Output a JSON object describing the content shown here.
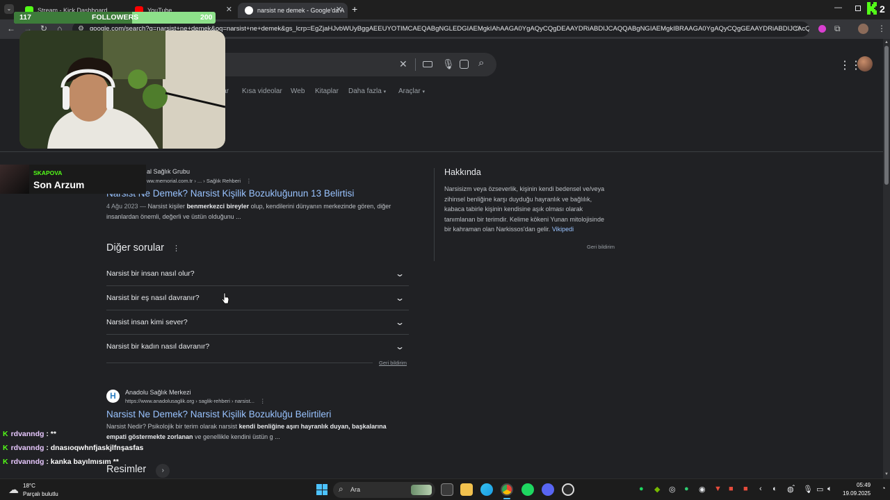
{
  "browser": {
    "tabs": [
      {
        "label": "Stream - Kick Dashboard",
        "active": false
      },
      {
        "label": "YouTube",
        "active": false
      },
      {
        "label": "narsist ne demek - Google'da A",
        "active": true
      }
    ],
    "new_tab": "+",
    "url": "google.com/search?q=narsist+ne+demek&oq=narsist+ne+demek&gs_lcrp=EgZjaHJvbWUyBggAEEUYOTIMCAEQABgNGLEDGIAEMgkIAhAAGA0YgAQyCQgDEAAYDRiABDIJCAQQABgNGIAEMgkIBRAAGA0YgAQyCQgGEAAYDRiABDIJCAcQABgN..."
  },
  "google": {
    "nav_tabs": [
      "lar",
      "Kısa videolar",
      "Web",
      "Kitaplar",
      "Daha fazla",
      "Araçlar"
    ],
    "result1": {
      "source_name": "al Sağlık Grubu",
      "source_url": "ww.memorial.com.tr › ... › Sağlık Rehberi",
      "title": "Narsist Ne Demek? Narsist Kişilik Bozukluğunun 13 Belirtisi",
      "date": "4 Ağu 2023 —",
      "snippet_a": " Narsist kişiler ",
      "snippet_b": "benmerkezci bireyler",
      "snippet_c": " olup, kendilerini dünyanın merkezinde gören, diğer",
      "snippet_line2": "insanlardan önemli, değerli ve üstün olduğunu ..."
    },
    "other_questions": {
      "heading": "Diğer sorular",
      "items": [
        "Narsist bir insan nasıl olur?",
        "Narsist bir eş nasıl davranır?",
        "Narsist insan kimi sever?",
        "Narsist bir kadın nasıl davranır?"
      ],
      "feedback": "Geri bildirim"
    },
    "result2": {
      "source_name": "Anadolu Sağlık Merkezi",
      "source_url": "https://www.anadolusaglik.org › saglik-rehberi › narsist...",
      "title": "Narsist Ne Demek? Narsist Kişilik Bozukluğu Belirtileri",
      "snippet_a": "Narsist Nedir? Psikolojik bir terim olarak narsist ",
      "snippet_b": "kendi benliğine aşırı hayranlık duyan, başkalarına",
      "snippet_c": "empati göstermekte zorlanan",
      "snippet_d": " ve genellikle kendini üstün g ..."
    },
    "images_heading": "Resimler",
    "about": {
      "heading": "Hakkında",
      "lines": [
        "Narsisizm veya özseverlik, kişinin kendi bedensel ve/veya",
        "zihinsel benliğine karşı duyduğu hayranlık ve bağlılık,",
        "kabaca tabirle kişinin kendisine aşık olması olarak",
        "tanımlanan bir terimdir. Kelime kökeni Yunan mitolojisinde",
        "bir kahraman olan Narkissos'dan gelir."
      ],
      "wiki_link": "Vikipedi",
      "feedback": "Geri bildirim"
    }
  },
  "overlay": {
    "followers_current": "117",
    "followers_label": "FOLLOWERS",
    "followers_goal": "200",
    "followers_progress": 0.585,
    "now_playing_artist": "SKAPOVA",
    "now_playing_title": "Son Arzum",
    "chat": [
      {
        "user": "rdvanndg",
        "msg": " : **"
      },
      {
        "user": "rdvanndg",
        "msg": " : dnasıoqwhnfjaskjlfnşasfas"
      },
      {
        "user": "rdvanndg",
        "msg": " : kanka bayılmısım **"
      }
    ]
  },
  "taskbar": {
    "weather_temp": "18°C",
    "weather_desc": "Parçalı bulutlu",
    "search_label": "Ara",
    "time": "05:49",
    "date": "19.09.2025"
  },
  "colors": {
    "kick_green": "#53fc18",
    "link_blue": "#99c3ff",
    "page_bg": "#202124"
  }
}
